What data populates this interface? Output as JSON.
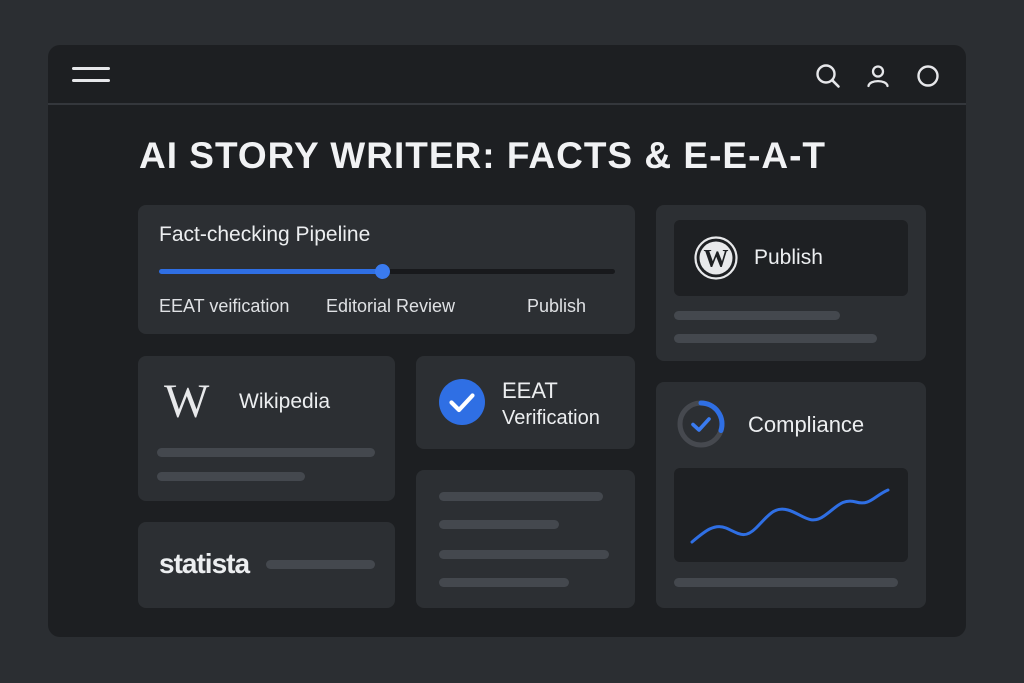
{
  "page": {
    "title": "AI STORY WRITER: FACTS & E-E-A-T"
  },
  "topbar": {
    "menu_icon": "hamburger-menu-icon",
    "icons": [
      "search-icon",
      "user-icon",
      "circle-icon"
    ]
  },
  "pipeline": {
    "title": "Fact-checking Pipeline",
    "progress": 0.49,
    "steps": [
      "EEAT veification",
      "Editorial Review",
      "Publish"
    ]
  },
  "publish": {
    "label": "Publish",
    "icon": "wordpress-icon"
  },
  "wikipedia": {
    "label": "Wikipedia",
    "icon": "wikipedia-icon"
  },
  "eeat": {
    "line1": "EEAT",
    "line2": "Verification",
    "icon": "check-circle-icon"
  },
  "compliance": {
    "label": "Compliance",
    "icon": "progress-check-icon",
    "progress": 0.3
  },
  "statista": {
    "label": "statista"
  },
  "colors": {
    "accent": "#3a7bf0",
    "window": "#1d1f22",
    "card": "#2c2f33",
    "background": "#2b2e32"
  }
}
